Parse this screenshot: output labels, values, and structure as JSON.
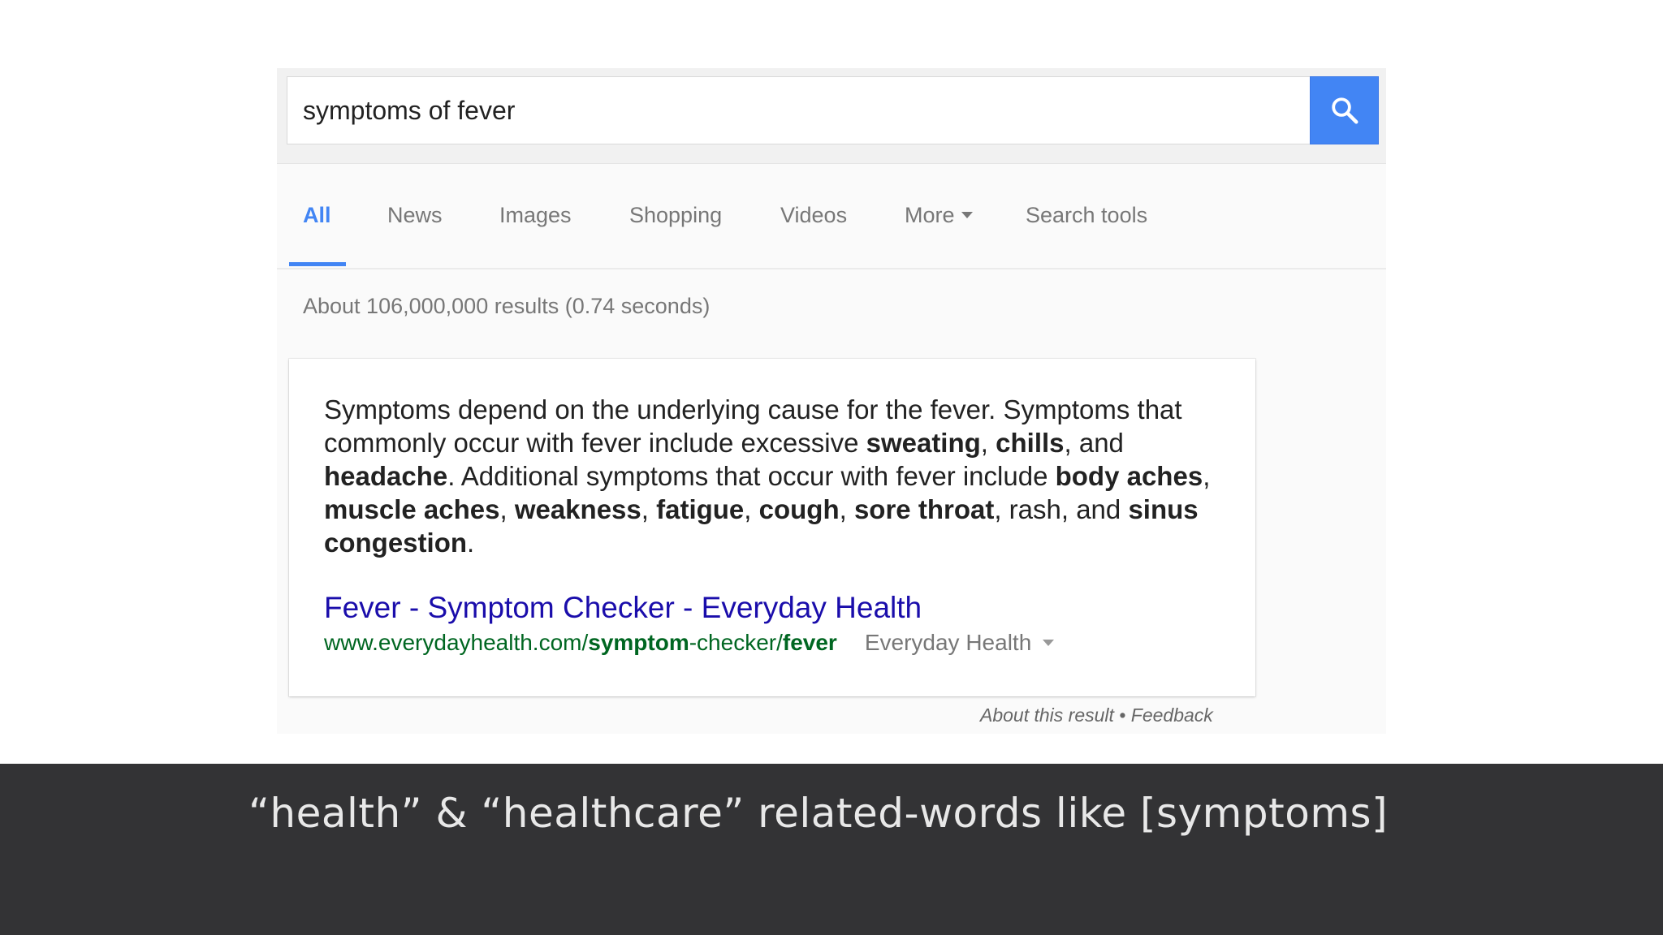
{
  "search": {
    "query": "symptoms of fever",
    "button_icon": "search-icon",
    "accent_color": "#4285f4"
  },
  "tabs": [
    {
      "label": "All",
      "active": true
    },
    {
      "label": "News"
    },
    {
      "label": "Images"
    },
    {
      "label": "Shopping"
    },
    {
      "label": "Videos"
    },
    {
      "label": "More"
    },
    {
      "label": "Search tools"
    }
  ],
  "result_stats": "About 106,000,000 results (0.74 seconds)",
  "featured_snippet": {
    "segments": [
      {
        "text": "Symptoms depend on the underlying cause for the fever. Symptoms that commonly occur with fever include excessive ",
        "bold": false
      },
      {
        "text": "sweating",
        "bold": true
      },
      {
        "text": ", ",
        "bold": false
      },
      {
        "text": "chills",
        "bold": true
      },
      {
        "text": ", and ",
        "bold": false
      },
      {
        "text": "headache",
        "bold": true
      },
      {
        "text": ". Additional symptoms that occur with fever include ",
        "bold": false
      },
      {
        "text": "body aches",
        "bold": true
      },
      {
        "text": ", ",
        "bold": false
      },
      {
        "text": "muscle aches",
        "bold": true
      },
      {
        "text": ", ",
        "bold": false
      },
      {
        "text": "weakness",
        "bold": true
      },
      {
        "text": ", ",
        "bold": false
      },
      {
        "text": "fatigue",
        "bold": true
      },
      {
        "text": ", ",
        "bold": false
      },
      {
        "text": "cough",
        "bold": true
      },
      {
        "text": ", ",
        "bold": false
      },
      {
        "text": "sore throat",
        "bold": true
      },
      {
        "text": ", rash, and ",
        "bold": false
      },
      {
        "text": "sinus congestion",
        "bold": true
      },
      {
        "text": ".",
        "bold": false
      }
    ],
    "result_title": "Fever - Symptom Checker - Everyday Health",
    "url_segments": [
      {
        "text": "www.everydayhealth.com/",
        "bold": false
      },
      {
        "text": "symptom",
        "bold": true
      },
      {
        "text": "-checker/",
        "bold": false
      },
      {
        "text": "fever",
        "bold": true
      }
    ],
    "source_name": "Everyday Health"
  },
  "footer": {
    "about_label": "About this result",
    "separator": " • ",
    "feedback_label": "Feedback"
  },
  "caption": "“health” & “healthcare” related-words like [symptoms]",
  "colors": {
    "link_title": "#1a0dab",
    "url_green": "#006621",
    "caption_band": "#333335"
  }
}
